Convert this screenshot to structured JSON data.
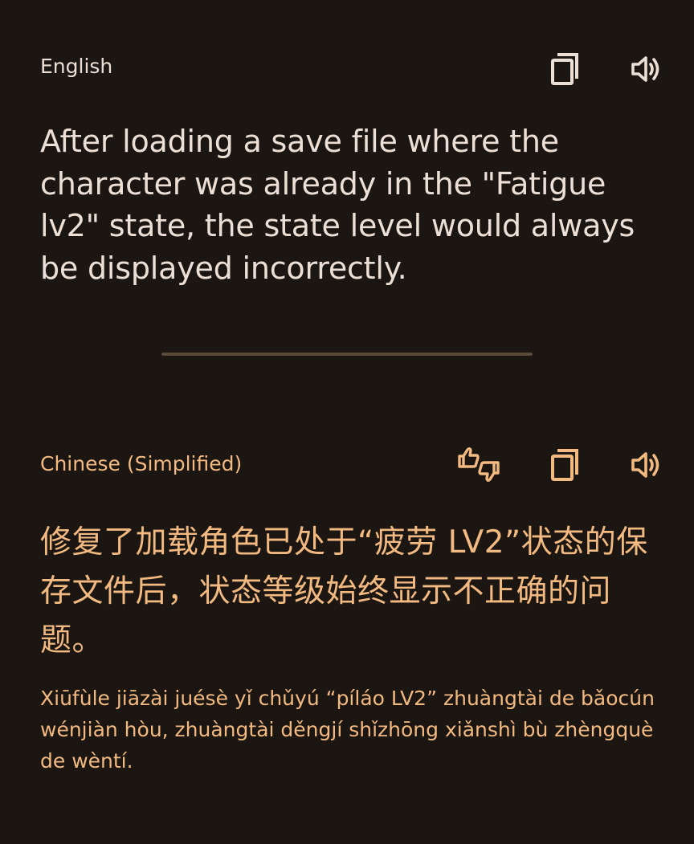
{
  "colors": {
    "background": "#1c1613",
    "source_text": "#ece0d6",
    "accent": "#f2b980",
    "divider": "#5b4938"
  },
  "source": {
    "language": "English",
    "text": "After loading a save file where the character was already in the \"Fatigue lv2\" state, the state level would always be displayed incorrectly.",
    "icons": [
      "copy-icon",
      "speaker-icon"
    ]
  },
  "translation": {
    "language": "Chinese (Simplified)",
    "text": "修复了加载角色已处于“疲劳 LV2”状态的保存文件后，状态等级始终显示不正确的问题。",
    "romanization": "Xiūfùle jiāzài juésè yǐ chǔyú “píláo LV2” zhuàngtài de bǎocún wénjiàn hòu, zhuàngtài děngjí shǐzhōng xiǎnshì bù zhèngquè de wèntí.",
    "icons": [
      "feedback-icon",
      "copy-icon",
      "speaker-icon"
    ]
  }
}
